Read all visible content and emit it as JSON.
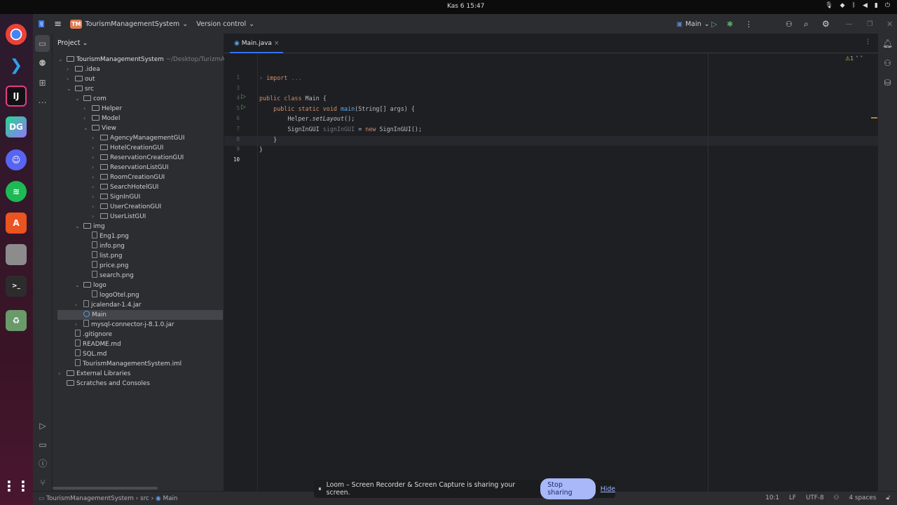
{
  "system": {
    "clock": "Kas 6  15:47"
  },
  "dock": [
    {
      "name": "chrome"
    },
    {
      "name": "vscode"
    },
    {
      "name": "intellij",
      "label": "IJ"
    },
    {
      "name": "datagrip",
      "label": "DG"
    },
    {
      "name": "discord"
    },
    {
      "name": "spotify"
    },
    {
      "name": "app-center"
    },
    {
      "name": "files"
    },
    {
      "name": "terminal",
      "label": ">_"
    },
    {
      "name": "trash"
    }
  ],
  "titlebar": {
    "project_badge": "TM",
    "project": "TourismManagementSystem",
    "vcs": "Version control",
    "run_config": "Main"
  },
  "project": {
    "title": "Project",
    "root": "TourismManagementSystem",
    "root_path": "~/Desktop/TurizmAc",
    "items": [
      {
        "label": ".idea",
        "lvl": 1,
        "type": "folder",
        "arrow": "›"
      },
      {
        "label": "out",
        "lvl": 1,
        "type": "folder",
        "arrow": "›"
      },
      {
        "label": "src",
        "lvl": 1,
        "type": "folder",
        "arrow": "⌄"
      },
      {
        "label": "com",
        "lvl": 2,
        "type": "folder",
        "arrow": "⌄"
      },
      {
        "label": "Helper",
        "lvl": 3,
        "type": "folder",
        "arrow": "›"
      },
      {
        "label": "Model",
        "lvl": 3,
        "type": "folder",
        "arrow": "›"
      },
      {
        "label": "View",
        "lvl": 3,
        "type": "folder",
        "arrow": "⌄"
      },
      {
        "label": "AgencyManagementGUI",
        "lvl": 4,
        "type": "form",
        "arrow": "›"
      },
      {
        "label": "HotelCreationGUI",
        "lvl": 4,
        "type": "form",
        "arrow": "›"
      },
      {
        "label": "ReservationCreationGUI",
        "lvl": 4,
        "type": "form",
        "arrow": "›"
      },
      {
        "label": "ReservationListGUI",
        "lvl": 4,
        "type": "form",
        "arrow": "›"
      },
      {
        "label": "RoomCreationGUI",
        "lvl": 4,
        "type": "form",
        "arrow": "›"
      },
      {
        "label": "SearchHotelGUI",
        "lvl": 4,
        "type": "form",
        "arrow": "›"
      },
      {
        "label": "SignInGUI",
        "lvl": 4,
        "type": "form",
        "arrow": "›"
      },
      {
        "label": "UserCreationGUI",
        "lvl": 4,
        "type": "form",
        "arrow": "›"
      },
      {
        "label": "UserListGUI",
        "lvl": 4,
        "type": "form",
        "arrow": "›"
      },
      {
        "label": "img",
        "lvl": 2,
        "type": "folder",
        "arrow": "⌄"
      },
      {
        "label": "Eng1.png",
        "lvl": 3,
        "type": "file",
        "arrow": ""
      },
      {
        "label": "info.png",
        "lvl": 3,
        "type": "file",
        "arrow": ""
      },
      {
        "label": "list.png",
        "lvl": 3,
        "type": "file",
        "arrow": ""
      },
      {
        "label": "price.png",
        "lvl": 3,
        "type": "file",
        "arrow": ""
      },
      {
        "label": "search.png",
        "lvl": 3,
        "type": "file",
        "arrow": ""
      },
      {
        "label": "logo",
        "lvl": 2,
        "type": "folder",
        "arrow": "⌄"
      },
      {
        "label": "logoOtel.png",
        "lvl": 3,
        "type": "file",
        "arrow": ""
      },
      {
        "label": "jcalendar-1.4.jar",
        "lvl": 2,
        "type": "jar",
        "arrow": "›"
      },
      {
        "label": "Main",
        "lvl": 2,
        "type": "java",
        "arrow": "",
        "selected": true
      },
      {
        "label": "mysql-connector-j-8.1.0.jar",
        "lvl": 2,
        "type": "jar",
        "arrow": "›"
      },
      {
        "label": ".gitignore",
        "lvl": 1,
        "type": "file",
        "arrow": ""
      },
      {
        "label": "README.md",
        "lvl": 1,
        "type": "file",
        "arrow": ""
      },
      {
        "label": "SQL.md",
        "lvl": 1,
        "type": "file",
        "arrow": ""
      },
      {
        "label": "TourismManagementSystem.iml",
        "lvl": 1,
        "type": "file",
        "arrow": ""
      },
      {
        "label": "External Libraries",
        "lvl": 0,
        "type": "lib",
        "arrow": "›"
      },
      {
        "label": "Scratches and Consoles",
        "lvl": 0,
        "type": "lib",
        "arrow": ""
      }
    ]
  },
  "editor": {
    "tab": "Main.java",
    "warnings": "1",
    "lines": [
      {
        "n": "1",
        "html": "<span class='gr'>›</span> <span class='kw'>import</span> <span class='gr'>...</span>"
      },
      {
        "n": "3",
        "html": ""
      },
      {
        "n": "4",
        "run": true,
        "html": "<span class='kw'>public class</span> Main {"
      },
      {
        "n": "5",
        "run": true,
        "html": "    <span class='kw'>public static void</span> <span class='fn'>main</span>(String[] args) {"
      },
      {
        "n": "6",
        "html": "        Helper.<span class='it'>setLayout</span>();"
      },
      {
        "n": "7",
        "html": "        SignInGUI <span class='gr'>signInGUI</span> = <span class='kw'>new</span> SignInGUI();"
      },
      {
        "n": "8",
        "html": "    }"
      },
      {
        "n": "9",
        "html": "}"
      },
      {
        "n": "10",
        "html": ""
      }
    ]
  },
  "statusbar": {
    "breadcrumb": [
      "TourismManagementSystem",
      "src",
      "Main"
    ],
    "position": "10:1",
    "line_sep": "LF",
    "encoding": "UTF-8",
    "indent": "4 spaces"
  },
  "loom": {
    "message": "Loom – Screen Recorder & Screen Capture is sharing your screen.",
    "stop": "Stop sharing",
    "hide": "Hide"
  }
}
